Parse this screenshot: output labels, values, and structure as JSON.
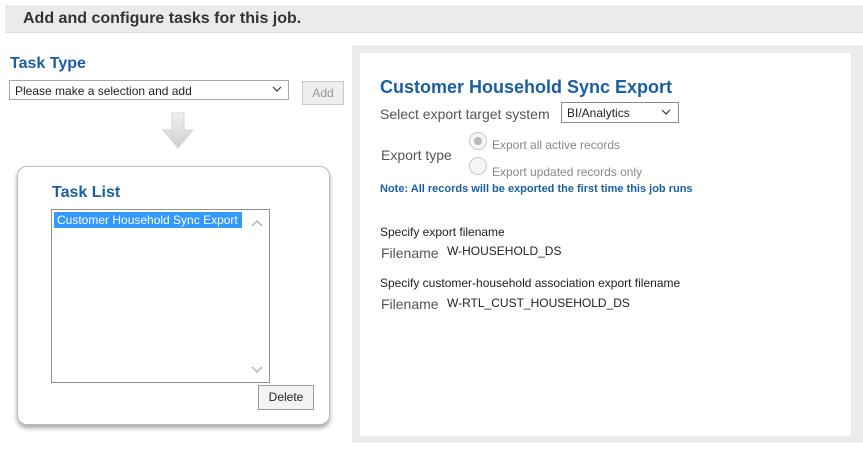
{
  "header": {
    "title": "Add and configure tasks for this job."
  },
  "task_type": {
    "label": "Task Type",
    "select_value": "Please make a selection and add",
    "add_label": "Add"
  },
  "task_list": {
    "title": "Task List",
    "items": [
      {
        "label": "Customer Household Sync Export",
        "selected": true
      }
    ],
    "delete_label": "Delete"
  },
  "config": {
    "title": "Customer Household Sync Export",
    "target_label": "Select export target system",
    "target_value": "BI/Analytics",
    "export_type_label": "Export type",
    "export_options": [
      {
        "label": "Export all active records",
        "selected": true
      },
      {
        "label": "Export updated records only",
        "selected": false
      }
    ],
    "note": "Note: All records will be exported the first time this job runs",
    "file1_caption": "Specify export filename",
    "file1_label": "Filename",
    "file1_value": "W-HOUSEHOLD_DS",
    "file2_caption": "Specify customer-household association export filename",
    "file2_label": "Filename",
    "file2_value": "W-RTL_CUST_HOUSEHOLD_DS"
  },
  "icons": {
    "dropdown": "chevron-down-icon",
    "arrow": "arrow-down-icon",
    "scroll_up": "chevron-up-icon",
    "scroll_down": "chevron-down-icon"
  },
  "colors": {
    "accent_blue": "#1a5fa3",
    "selection_blue": "#3399ff",
    "header_gray": "#ebebeb"
  }
}
